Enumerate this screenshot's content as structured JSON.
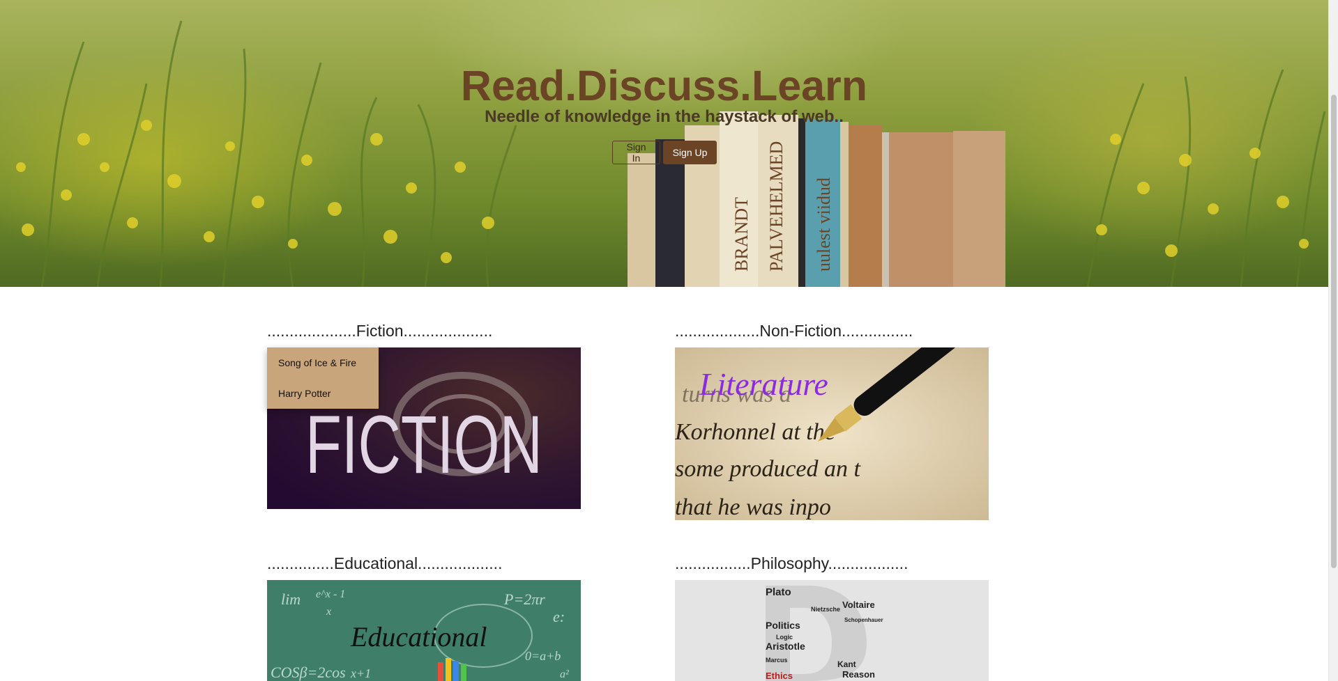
{
  "hero": {
    "title": "Read.Discuss.Learn",
    "subtitle": "Needle of knowledge in the haystack of web..",
    "signin_label": "Sign In",
    "signup_label": "Sign Up"
  },
  "categories": [
    {
      "heading": "....................Fiction....................",
      "image_text": "FICTION"
    },
    {
      "heading": "...................Non-Fiction................",
      "image_text": "Literature",
      "letter_lines": [
        "turns was d",
        "Korhonnel at the",
        "some produced an t",
        "that he was inpo"
      ]
    },
    {
      "heading": "...............Educational...................",
      "image_text": "Educational",
      "formulas": [
        "lim",
        "e^x - 1",
        "x",
        "P=2πr",
        "e:",
        "COSβ=2cos",
        "x+1",
        "0=a+b",
        "a²"
      ]
    },
    {
      "heading": ".................Philosophy..................",
      "words": [
        "Plato",
        "Voltaire",
        "Politics",
        "Aristotle",
        "Schopenhauer",
        "Kant",
        "Reason",
        "Ethics",
        "Marcus",
        "Nietzsche",
        "Logic"
      ]
    }
  ],
  "fiction_menu": {
    "items": [
      {
        "label": "Song of Ice & Fire"
      },
      {
        "label": "Harry Potter"
      }
    ]
  },
  "colors": {
    "brand": "#6b4426",
    "dropdown": "#c9a57c"
  }
}
